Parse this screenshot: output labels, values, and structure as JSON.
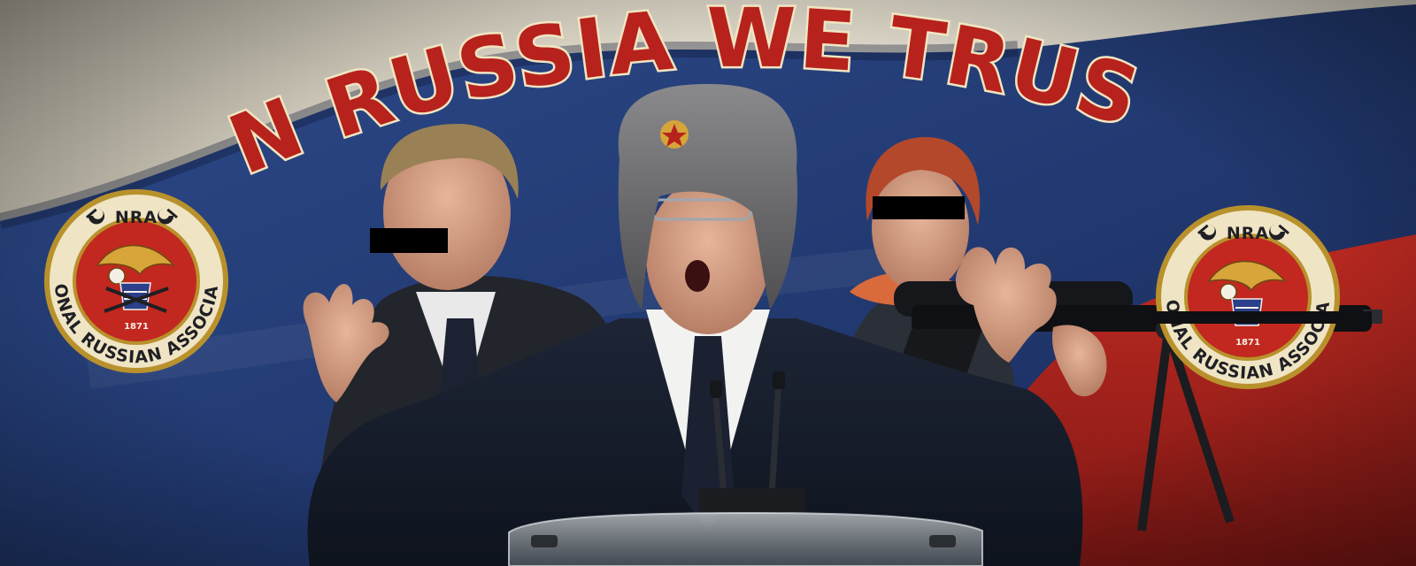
{
  "banner": {
    "headline": "IN RUSSIA WE TRUST",
    "colors": {
      "flag_white": "#d8d2c0",
      "flag_blue": "#22407e",
      "flag_red": "#b0231d",
      "headline_fill": "#b7221c",
      "headline_outline": "#f1e5c2",
      "seal_ring": "#b8912c",
      "seal_red": "#c2281f",
      "seal_cream": "#efe4c4"
    }
  },
  "seals": {
    "left": {
      "top_text": "NRA",
      "arc_text": "NATIONAL RUSSIAN ASSOCIATION",
      "year": "1871",
      "hammer_sickle": "hammer-sickle-icon"
    },
    "right": {
      "top_text": "NRA",
      "arc_text": "NATIONAL RUSSIAN ASSOCIATION",
      "year": "1871",
      "hammer_sickle": "hammer-sickle-icon"
    }
  }
}
